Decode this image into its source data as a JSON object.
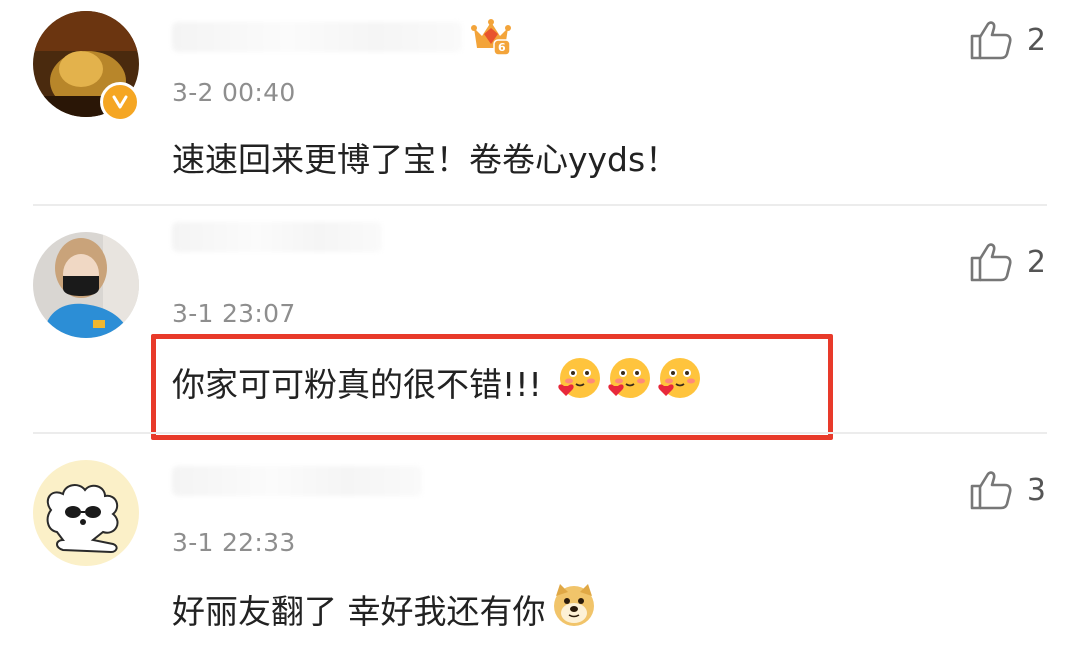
{
  "comments": [
    {
      "timestamp": "3-2 00:40",
      "text": "速速回来更博了宝！卷卷心yyds！",
      "likes": "2",
      "badge_icon": "vip-crown-icon",
      "badge_level": "6",
      "avatar_icon": "user-avatar-dark"
    },
    {
      "timestamp": "3-1 23:07",
      "text": "你家可可粉真的很不错!!!",
      "likes": "2",
      "emojis": [
        "love-face-emoji",
        "love-face-emoji",
        "love-face-emoji"
      ],
      "highlighted": true,
      "avatar_icon": "user-avatar-girl-mask"
    },
    {
      "timestamp": "3-1 22:33",
      "text": "好丽友翻了 幸好我还有你",
      "likes": "3",
      "emojis": [
        "doge-emoji"
      ],
      "avatar_icon": "user-avatar-cartoon-dog"
    }
  ],
  "colors": {
    "highlight_border": "#e83a2a",
    "timestamp": "#8e8e8e",
    "verified_badge": "#f5a623"
  }
}
